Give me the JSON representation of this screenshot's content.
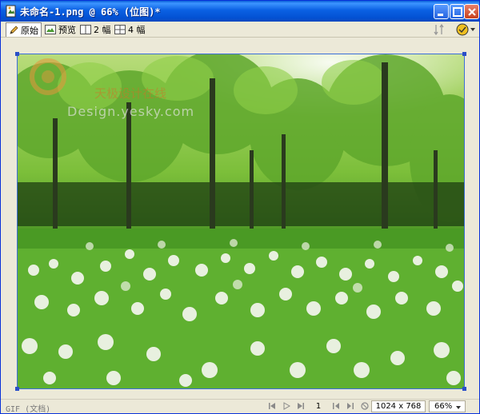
{
  "window": {
    "title": "未命名-1.png @ 66% (位图)*",
    "controls": [
      "minimize-icon",
      "maximize-icon",
      "close-icon"
    ]
  },
  "toolbar": {
    "tabs": [
      {
        "label": "原始",
        "icon": "pencil-icon",
        "active": true
      },
      {
        "label": "预览",
        "icon": "preview-icon",
        "active": false
      },
      {
        "label": "2 幅",
        "icon": "two-up-icon",
        "active": false
      },
      {
        "label": "4 幅",
        "icon": "four-up-icon",
        "active": false
      }
    ],
    "right_icons": [
      "sort-icon",
      "onion-skin-icon"
    ]
  },
  "canvas": {
    "watermark_line1": "天极设计在线",
    "watermark_line2": "Design.yesky.com"
  },
  "status": {
    "format": "GIF (文档)",
    "frame": "1",
    "dimensions": "1024 x 768",
    "zoom": "66%"
  },
  "colors": {
    "titlebar": "#0b61e3",
    "selection_border": "#3c6fd8"
  }
}
